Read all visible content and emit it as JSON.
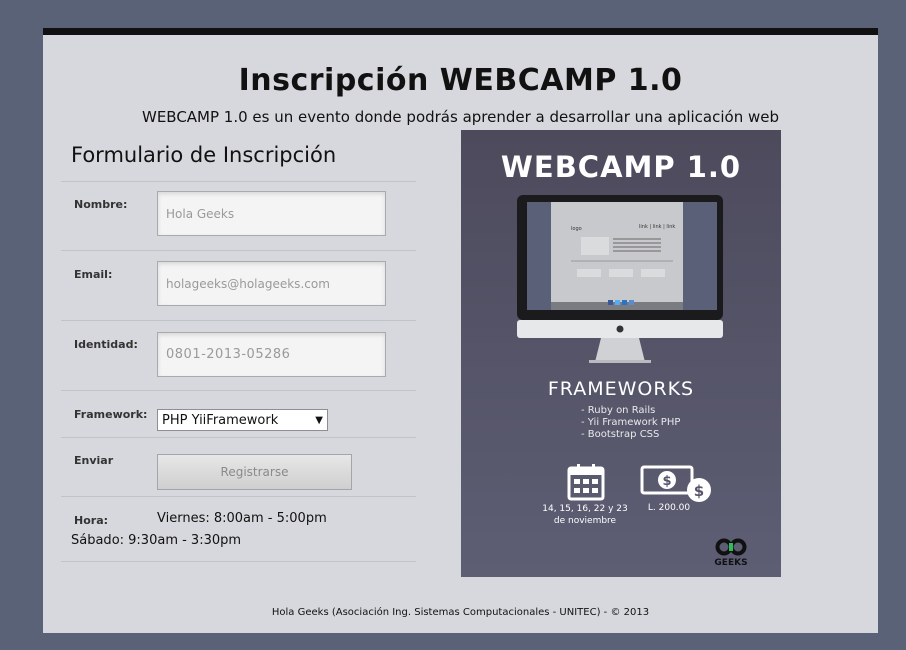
{
  "page": {
    "title": "Inscripción WEBCAMP 1.0",
    "subtitle": "WEBCAMP 1.0 es un evento donde podrás aprender a desarrollar una aplicación web"
  },
  "form": {
    "title": "Formulario de Inscripción",
    "nombre_label": "Nombre:",
    "nombre_placeholder": "Hola Geeks",
    "email_label": "Email:",
    "email_placeholder": "holageeks@holageeks.com",
    "identidad_label": "Identidad:",
    "identidad_placeholder": "0801-2013-05286",
    "framework_label": "Framework:",
    "framework_selected": "PHP YiiFramework",
    "enviar_label": "Enviar",
    "submit_label": "Registrarse",
    "hora_label": "Hora:",
    "hours_friday": "Viernes: 8:00am - 5:00pm",
    "hours_saturday": "Sábado: 9:30am - 3:30pm"
  },
  "poster": {
    "title": "WEBCAMP 1.0",
    "screen_logo": "logo",
    "screen_links": "link | link | link",
    "frameworks_title": "FRAMEWORKS",
    "frameworks": [
      "- Ruby on Rails",
      "- Yii Framework PHP",
      "- Bootstrap CSS"
    ],
    "dates_line1": "14, 15, 16, 22 y 23",
    "dates_line2": "de noviembre",
    "price": "L. 200.00",
    "logo_text": "GEEKS"
  },
  "footer": {
    "text": "Hola Geeks (Asociación Ing. Sistemas Computacionales - UNITEC) - © 2013"
  },
  "colors": {
    "background": "#5a6278",
    "card": "#d7d8dd",
    "poster": "#55546a"
  }
}
